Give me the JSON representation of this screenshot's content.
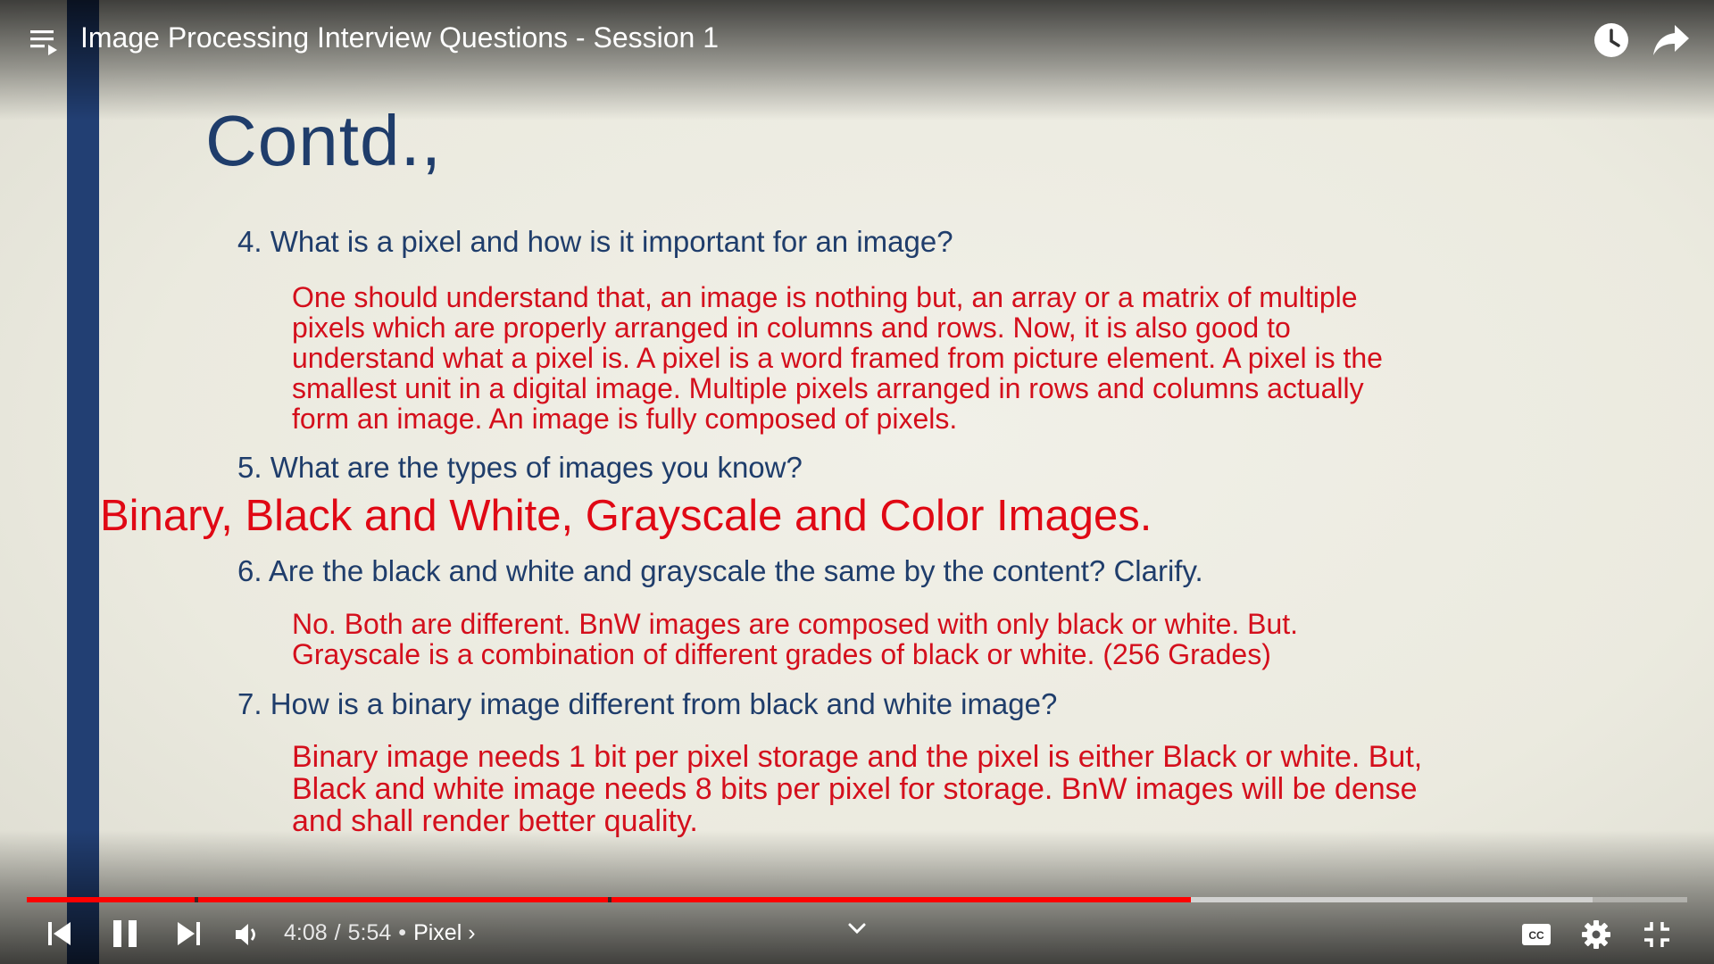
{
  "video": {
    "title": "Image Processing Interview Questions - Session 1"
  },
  "slide": {
    "title": "Contd.,",
    "questions": [
      {
        "q": "4. What is a pixel and how is it important for an image?",
        "lines": [
          "One should understand that, an image is nothing but, an array or a matrix of multiple",
          "pixels which are properly arranged in columns and rows. Now, it is also good to",
          "understand what a pixel is. A pixel is a word framed from picture element. A pixel is the",
          "smallest unit in a digital image. Multiple pixels arranged in rows and columns actually",
          "form an image. An image is fully composed of pixels."
        ]
      },
      {
        "q": "5. What are the types of images you know?",
        "big_answer": "Binary, Black and White, Grayscale and Color Images."
      },
      {
        "q": "6. Are the black and white and grayscale the same by the content? Clarify.",
        "lines": [
          "No. Both are different. BnW images are composed with only black or white. But.",
          "Grayscale is a combination of different grades of black or white. (256 Grades)"
        ]
      },
      {
        "q": "7. How is a binary image different from black and white image?",
        "lines": [
          "Binary image needs 1 bit per pixel storage and the pixel is either Black or white. But,",
          "Black and white image needs 8 bits per pixel for storage. BnW images will be dense",
          "and shall render better quality."
        ]
      }
    ]
  },
  "player": {
    "current_time": "4:08",
    "duration_separator": "/",
    "duration": "5:54",
    "bullet": "•",
    "chapter": "Pixel ›",
    "progress_played": 0.701,
    "progress_buffered": 0.943,
    "chapter_marks": [
      0.101,
      0.35
    ],
    "colors": {
      "played": "#ff0000",
      "title_blue": "#1f3d6b",
      "answer_red": "#d40f1c"
    },
    "icons": [
      "playlist-icon",
      "watch-later-icon",
      "share-icon",
      "previous-icon",
      "pause-icon",
      "next-icon",
      "volume-icon",
      "chevron-down-icon",
      "captions-icon",
      "settings-icon",
      "exit-fullscreen-icon"
    ]
  }
}
